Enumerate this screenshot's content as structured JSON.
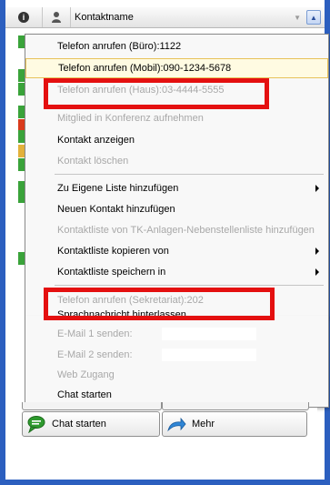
{
  "list": {
    "header": {
      "info_icon": "info-icon",
      "person_icon": "person-icon",
      "column_label": "Kontaktname"
    },
    "status_strip_colors": [
      "#3aa33a",
      "#3aa33a",
      "#3aa33a",
      "#3aa33a",
      "#d93b1c",
      "#3aa33a",
      "#e3b13a",
      "#3aa33a",
      "#3aa33a",
      "#3aa33a",
      "#3aa33a"
    ]
  },
  "context_menu": {
    "items": [
      {
        "label": "Telefon anrufen (Büro):1122",
        "enabled": true,
        "highlighted": false
      },
      {
        "label": "Telefon anrufen (Mobil):090-1234-5678",
        "enabled": true,
        "highlighted": true
      },
      {
        "label": "Telefon anrufen (Haus):03-4444-5555",
        "enabled": false,
        "highlighted": false
      },
      {
        "label": "Mitglied in Konferenz aufnehmen",
        "enabled": false,
        "highlighted": false
      },
      {
        "label": "Kontakt anzeigen",
        "enabled": true,
        "highlighted": false
      },
      {
        "label": "Kontakt löschen",
        "enabled": false,
        "highlighted": false
      },
      {
        "label": "Zu Eigene Liste hinzufügen",
        "enabled": true,
        "submenu": true
      },
      {
        "label": "Neuen Kontakt hinzufügen",
        "enabled": true
      },
      {
        "label": "Kontaktliste von TK-Anlagen-Nebenstellenliste hinzufügen",
        "enabled": false
      },
      {
        "label": "Kontaktliste kopieren von",
        "enabled": true,
        "submenu": true
      },
      {
        "label": "Kontaktliste speichern in",
        "enabled": true,
        "submenu": true
      },
      {
        "label": "Telefon anrufen (Sekretariat):202",
        "enabled": false
      },
      {
        "label": "Sprachnachricht hinterlassen",
        "enabled": true
      },
      {
        "label": "E-Mail 1 senden:",
        "enabled": false
      },
      {
        "label": "E-Mail 2 senden:",
        "enabled": false
      },
      {
        "label": "Web Zugang",
        "enabled": false
      },
      {
        "label": "Chat starten",
        "enabled": true
      }
    ]
  },
  "annotations": {
    "color": "#e41010"
  },
  "bottom_panel": {
    "chat_button_label": "Chat starten",
    "chat_icon": "chat-bubble-icon",
    "more_button_label": "Mehr",
    "more_icon": "arrow-curve-icon"
  }
}
